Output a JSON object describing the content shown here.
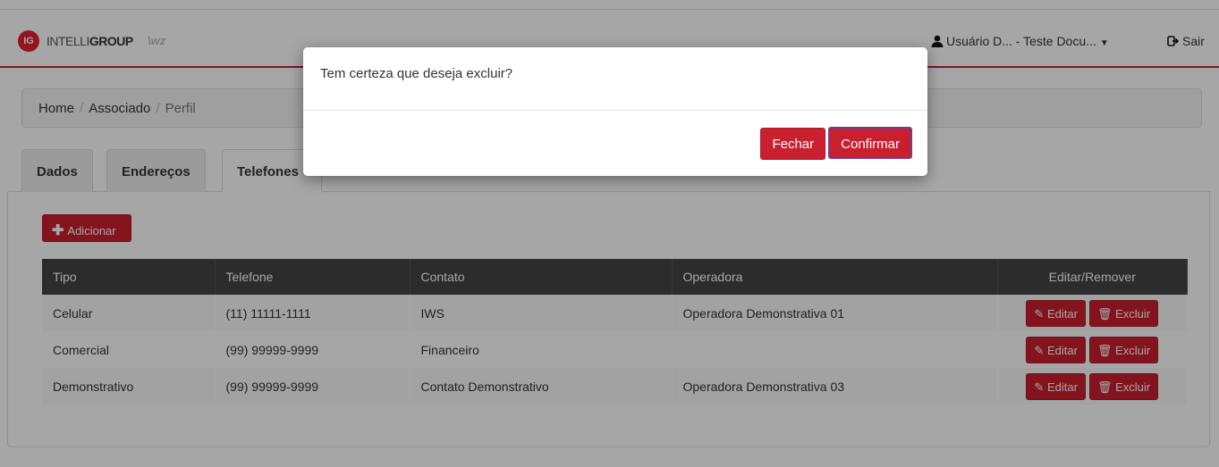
{
  "header": {
    "logo_badge": "IG",
    "brand_light": "INTELLI",
    "brand_bold": "GROUP",
    "brand_mark": "\\wz",
    "user_label": "Usuário D... - Teste Docu...",
    "logout_label": "Sair"
  },
  "breadcrumb": [
    "Home",
    "Associado",
    "Perfil"
  ],
  "tabs": [
    "Dados",
    "Endereços",
    "Telefones"
  ],
  "add_button": "Adicionar",
  "table": {
    "columns": [
      "Tipo",
      "Telefone",
      "Contato",
      "Operadora",
      "Editar/Remover"
    ],
    "rows": [
      {
        "tipo": "Celular",
        "telefone": "(11) 11111-1111",
        "contato": "IWS",
        "operadora": "Operadora Demonstrativa 01"
      },
      {
        "tipo": "Comercial",
        "telefone": "(99) 99999-9999",
        "contato": "Financeiro",
        "operadora": ""
      },
      {
        "tipo": "Demonstrativo",
        "telefone": "(99) 99999-9999",
        "contato": "Contato Demonstrativo",
        "operadora": "Operadora Demonstrativa 03"
      }
    ],
    "edit_label": "Editar",
    "delete_label": "Excluir"
  },
  "modal": {
    "message": "Tem certeza que deseja excluir?",
    "close_label": "Fechar",
    "confirm_label": "Confirmar"
  },
  "colors": {
    "accent": "#c9202f",
    "table_header": "#444444"
  }
}
